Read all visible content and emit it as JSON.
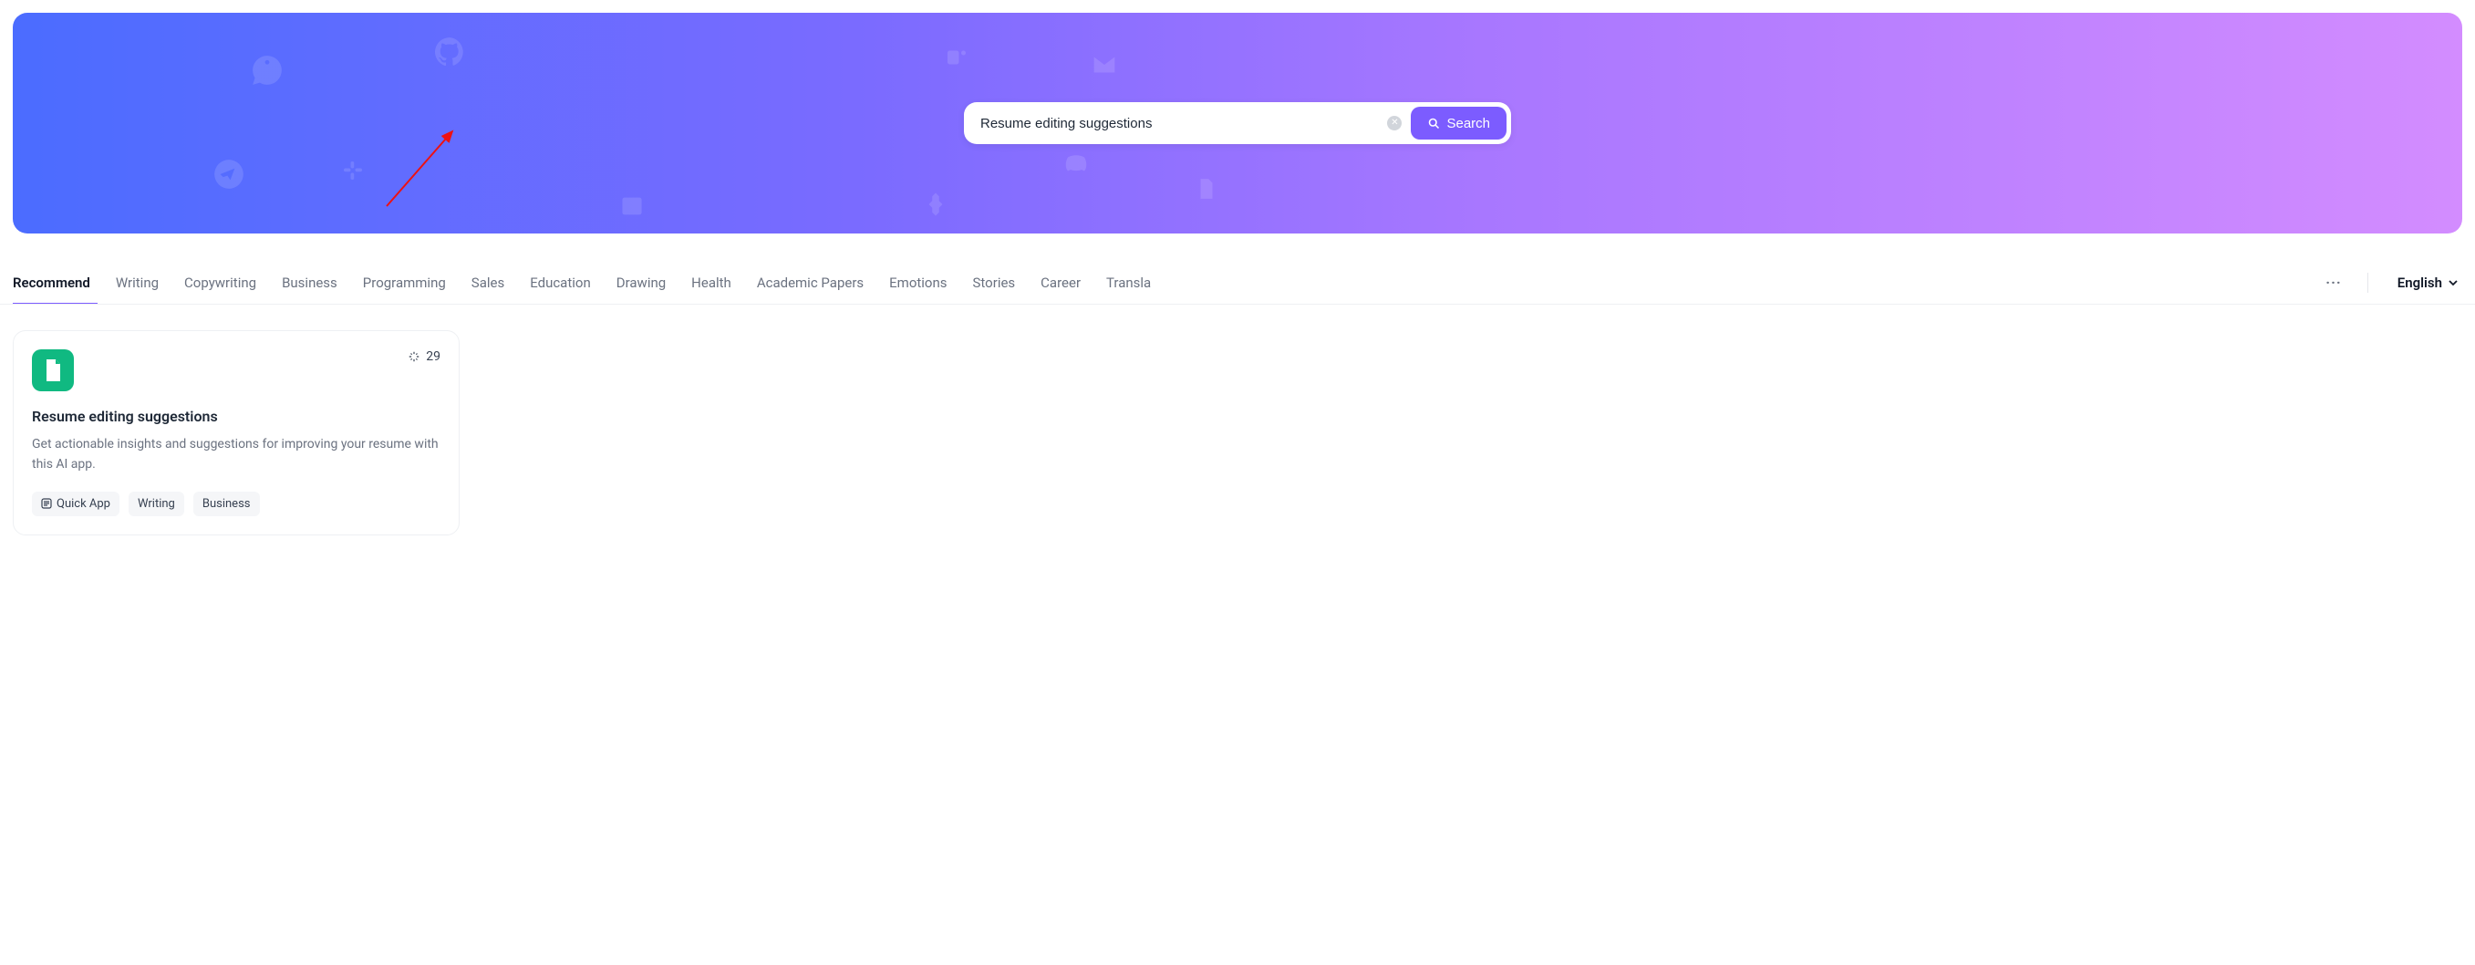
{
  "search": {
    "value": "Resume editing suggestions",
    "button_label": "Search"
  },
  "tabs": {
    "items": [
      {
        "label": "Recommend",
        "active": true
      },
      {
        "label": "Writing",
        "active": false
      },
      {
        "label": "Copywriting",
        "active": false
      },
      {
        "label": "Business",
        "active": false
      },
      {
        "label": "Programming",
        "active": false
      },
      {
        "label": "Sales",
        "active": false
      },
      {
        "label": "Education",
        "active": false
      },
      {
        "label": "Drawing",
        "active": false
      },
      {
        "label": "Health",
        "active": false
      },
      {
        "label": "Academic Papers",
        "active": false
      },
      {
        "label": "Emotions",
        "active": false
      },
      {
        "label": "Stories",
        "active": false
      },
      {
        "label": "Career",
        "active": false
      },
      {
        "label": "Transla",
        "active": false
      }
    ],
    "more_label": "···"
  },
  "language": {
    "selected": "English"
  },
  "results": [
    {
      "title": "Resume editing suggestions",
      "description": "Get actionable insights and suggestions for improving your resume with this AI app.",
      "count": "29",
      "icon": "document-icon",
      "tags": [
        {
          "label": "Quick App",
          "has_icon": true
        },
        {
          "label": "Writing",
          "has_icon": false
        },
        {
          "label": "Business",
          "has_icon": false
        }
      ]
    }
  ]
}
